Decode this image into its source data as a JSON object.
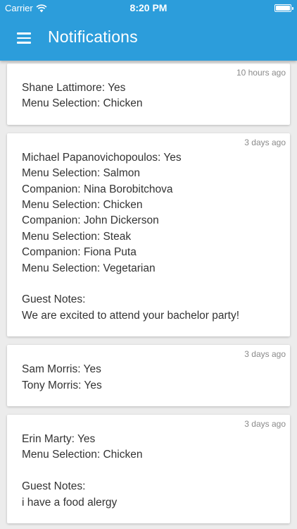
{
  "status_bar": {
    "carrier": "Carrier",
    "time": "8:20 PM"
  },
  "header": {
    "title": "Notifications"
  },
  "notifications": [
    {
      "time": "10 hours ago",
      "lines": [
        "Shane Lattimore: Yes",
        "Menu Selection: Chicken"
      ]
    },
    {
      "time": "3 days ago",
      "lines": [
        "Michael Papanovichopoulos: Yes",
        "Menu Selection: Salmon",
        "Companion: Nina Borobitchova",
        "Menu Selection: Chicken",
        "Companion: John Dickerson",
        "Menu Selection: Steak",
        "Companion: Fiona Puta",
        "Menu Selection: Vegetarian",
        "",
        "Guest Notes:",
        "We are excited to attend your bachelor party!"
      ]
    },
    {
      "time": "3 days ago",
      "lines": [
        "Sam Morris: Yes",
        "Tony Morris: Yes"
      ]
    },
    {
      "time": "3 days ago",
      "lines": [
        "Erin Marty: Yes",
        "Menu Selection: Chicken",
        "",
        "Guest Notes:",
        "i have a food alergy"
      ]
    }
  ]
}
